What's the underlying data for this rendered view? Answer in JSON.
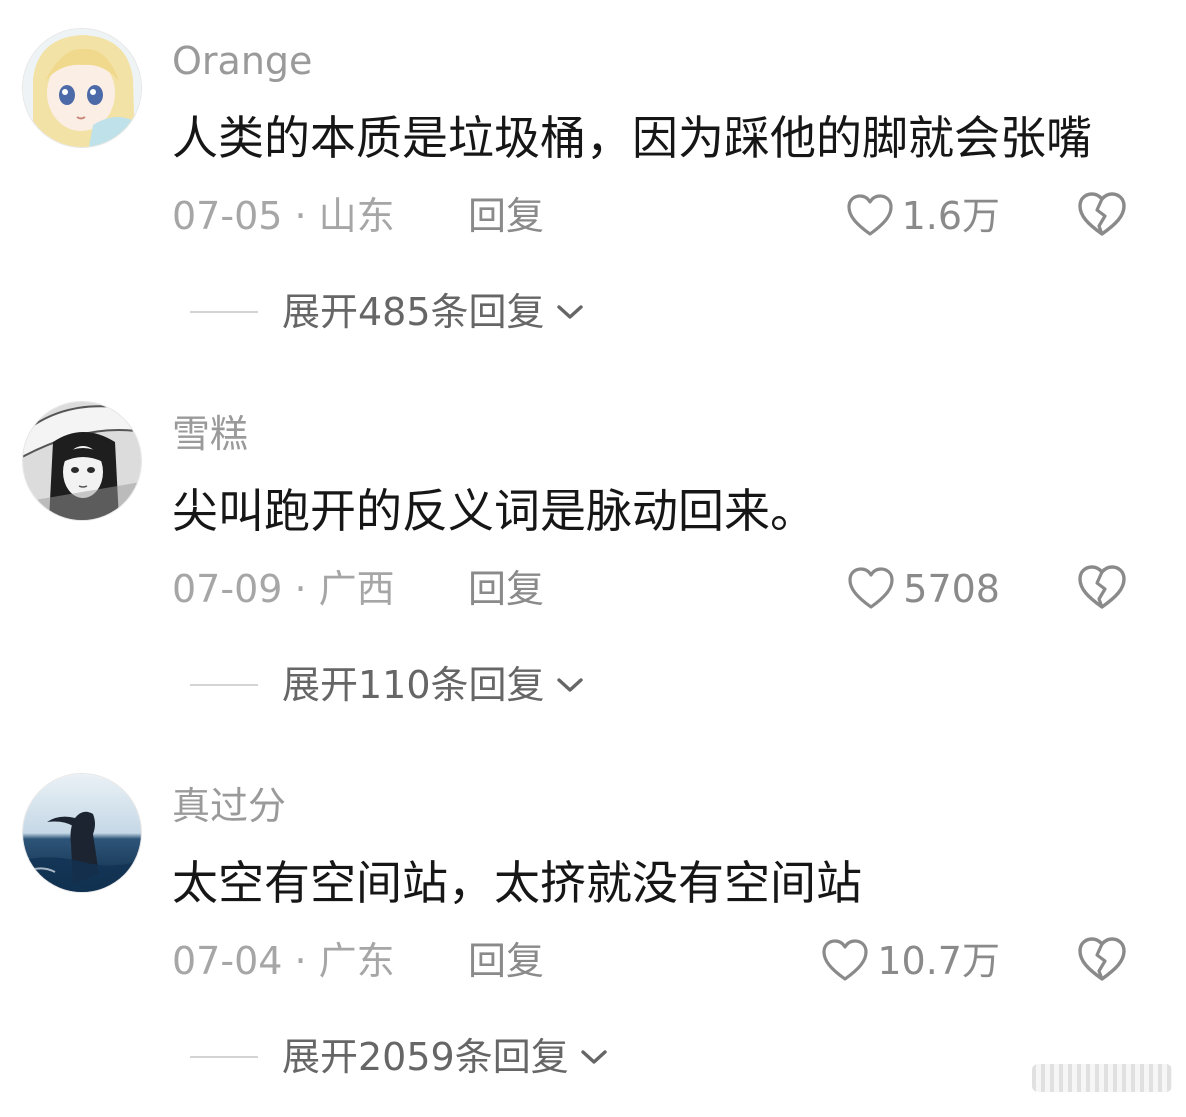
{
  "comments": [
    {
      "username": "Orange",
      "content": "人类的本质是垃圾桶，因为踩他的脚就会张嘴",
      "meta": "07-05 · 山东",
      "reply_label": "回复",
      "likes": "1.6万",
      "expand_label": "展开485条回复",
      "avatar_icon": "anime-blonde-girl-avatar"
    },
    {
      "username": "雪糕",
      "content": "尖叫跑开的反义词是脉动回来。",
      "meta": "07-09 · 广西",
      "reply_label": "回复",
      "likes": "5708",
      "expand_label": "展开110条回复",
      "avatar_icon": "manga-girl-with-umbrella-avatar"
    },
    {
      "username": "真过分",
      "content": "太空有空间站，太挤就没有空间站",
      "meta": "07-04 · 广东",
      "reply_label": "回复",
      "likes": "10.7万",
      "expand_label": "展开2059条回复",
      "avatar_icon": "girl-at-sea-avatar"
    }
  ],
  "icons": {
    "like": "heart-outline-icon",
    "dislike": "broken-heart-icon",
    "expand": "chevron-down-icon"
  },
  "colors": {
    "username": "#9a9a9a",
    "content": "#161616",
    "meta": "#a6a6a6",
    "action": "#8a8a8a",
    "expand": "#666666"
  }
}
